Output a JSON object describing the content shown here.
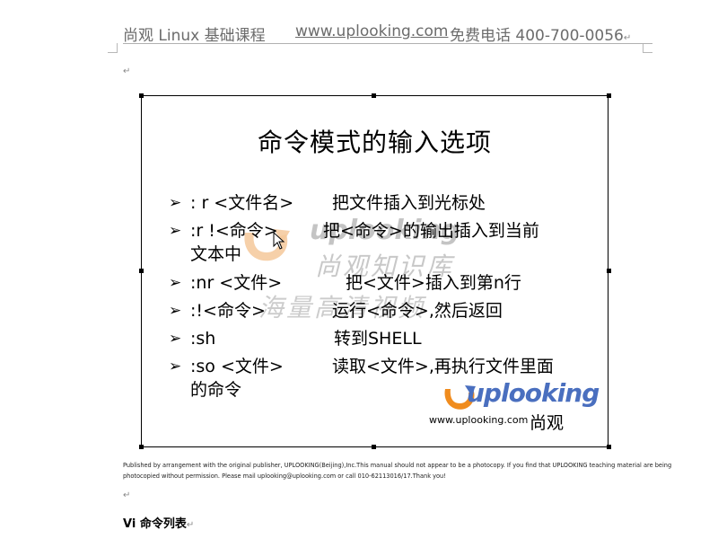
{
  "header": {
    "course_title": "尚观 Linux 基础课程",
    "site_url": "www.uplooking.com",
    "phone": "免费电话 400-700-0056",
    "return_mark": "↵"
  },
  "paragraph_marks": {
    "after_header": "↵",
    "after_notice": "↵"
  },
  "slide": {
    "title": "命令模式的输入选项",
    "bullet_symbol": "➢",
    "items": [
      {
        "command": ": r <文件名>",
        "description": "把文件插入到光标处",
        "continuation": ""
      },
      {
        "command": ":r !<命令>",
        "description": "把<命令>的输出插入到当前",
        "continuation": "文本中"
      },
      {
        "command": ":nr <文件>",
        "description": "把<文件>插入到第n行",
        "continuation": ""
      },
      {
        "command": ":!<命令>",
        "description": "运行<命令>,然后返回",
        "continuation": ""
      },
      {
        "command": ":sh",
        "description": "转到SHELL",
        "continuation": ""
      },
      {
        "command": ":so <文件>",
        "description": "读取<文件>,再执行文件里面",
        "continuation": "的命令"
      }
    ],
    "logo": {
      "wordmark": "uplooking",
      "url": "www.uplooking.com",
      "cn_name": "尚观"
    },
    "watermark": {
      "wordmark": "uplooking",
      "line1": "尚观知识库",
      "line2": "海量高清视频"
    }
  },
  "notice": {
    "line1": "Published by arrangement with the original publisher, UPLOOKING(Beijing),Inc.This manual should not appear to be a photocopy. If you find that UPLOOKING teaching material are being",
    "line2": "photocopied without permission. Please mail uplooking@uplooking.com or call 010-62113016/17.Thank you!"
  },
  "section": {
    "heading": "Vi  命令列表",
    "return_mark": "↵"
  },
  "colors": {
    "logo_blue": "#4a6fbf",
    "logo_orange": "#f08c1e",
    "header_gray": "#6c6c6c",
    "watermark_gray": "#c4c4c4"
  }
}
